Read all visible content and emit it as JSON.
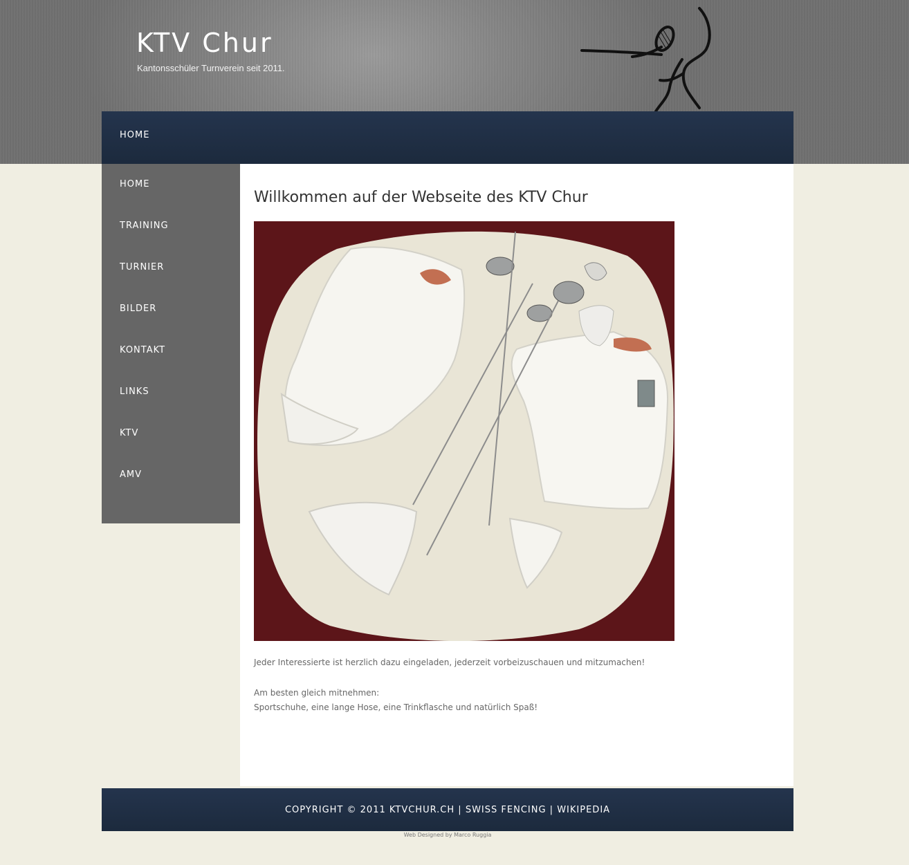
{
  "header": {
    "title": "KTV Chur",
    "tagline": "Kantonsschüler Turnverein seit 2011."
  },
  "topnav": {
    "items": [
      {
        "label": "HOME"
      }
    ]
  },
  "sidebar": {
    "items": [
      {
        "label": "HOME"
      },
      {
        "label": "TRAINING"
      },
      {
        "label": "TURNIER"
      },
      {
        "label": "BILDER"
      },
      {
        "label": "KONTAKT"
      },
      {
        "label": "LINKS"
      },
      {
        "label": "KTV"
      },
      {
        "label": "AMV"
      }
    ]
  },
  "main": {
    "heading": "Willkommen auf der Webseite des KTV Chur",
    "intro": "Jeder Interessierte ist herzlich dazu eingeladen, jederzeit vorbeizuschauen und mitzumachen!",
    "bring_label": "Am besten gleich mitnehmen:",
    "bring_list": "Sportschuhe, eine lange Hose, eine Trinkflasche und natürlich Spaß!"
  },
  "footer": {
    "copyright": "COPYRIGHT © 2011 KTVCHUR.CH",
    "separator": "|",
    "link1": "SWISS FENCING",
    "link2": "WIKIPEDIA",
    "credit": "Web Designed by Marco Ruggia"
  },
  "colors": {
    "nav_bar": "#1f2d42",
    "sidebar": "#666666",
    "page_background": "#f0eee2",
    "header_gray": "#8a8a8a"
  },
  "icons": [
    "fencer-logo"
  ]
}
